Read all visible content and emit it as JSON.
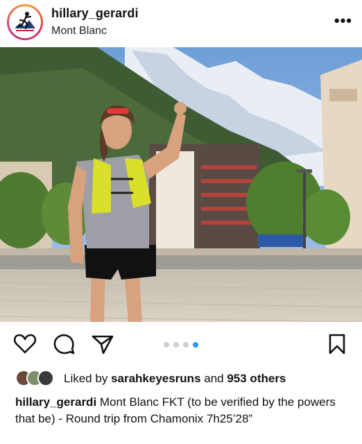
{
  "post": {
    "username": "hillary_gerardi",
    "location": "Mont Blanc",
    "more_label": "•••",
    "image_description_icon": "photo-icon"
  },
  "carousel": {
    "count": 4,
    "active_index": 3
  },
  "icons": {
    "like": "heart-icon",
    "comment": "comment-icon",
    "share": "send-icon",
    "save": "bookmark-icon"
  },
  "likes": {
    "prefix": "Liked by ",
    "liked_by": "sarahkeyesruns",
    "middle": " and ",
    "others": "953 others"
  },
  "caption": {
    "username": "hillary_gerardi",
    "text": " Mont Blanc FKT (to be verified by the powers that be) - Round trip from Chamonix 7h25’28”"
  },
  "colors": {
    "carousel_active": "#2a9af3",
    "carousel_inactive": "#cfcfcf",
    "story_ring": "#e1306c"
  }
}
